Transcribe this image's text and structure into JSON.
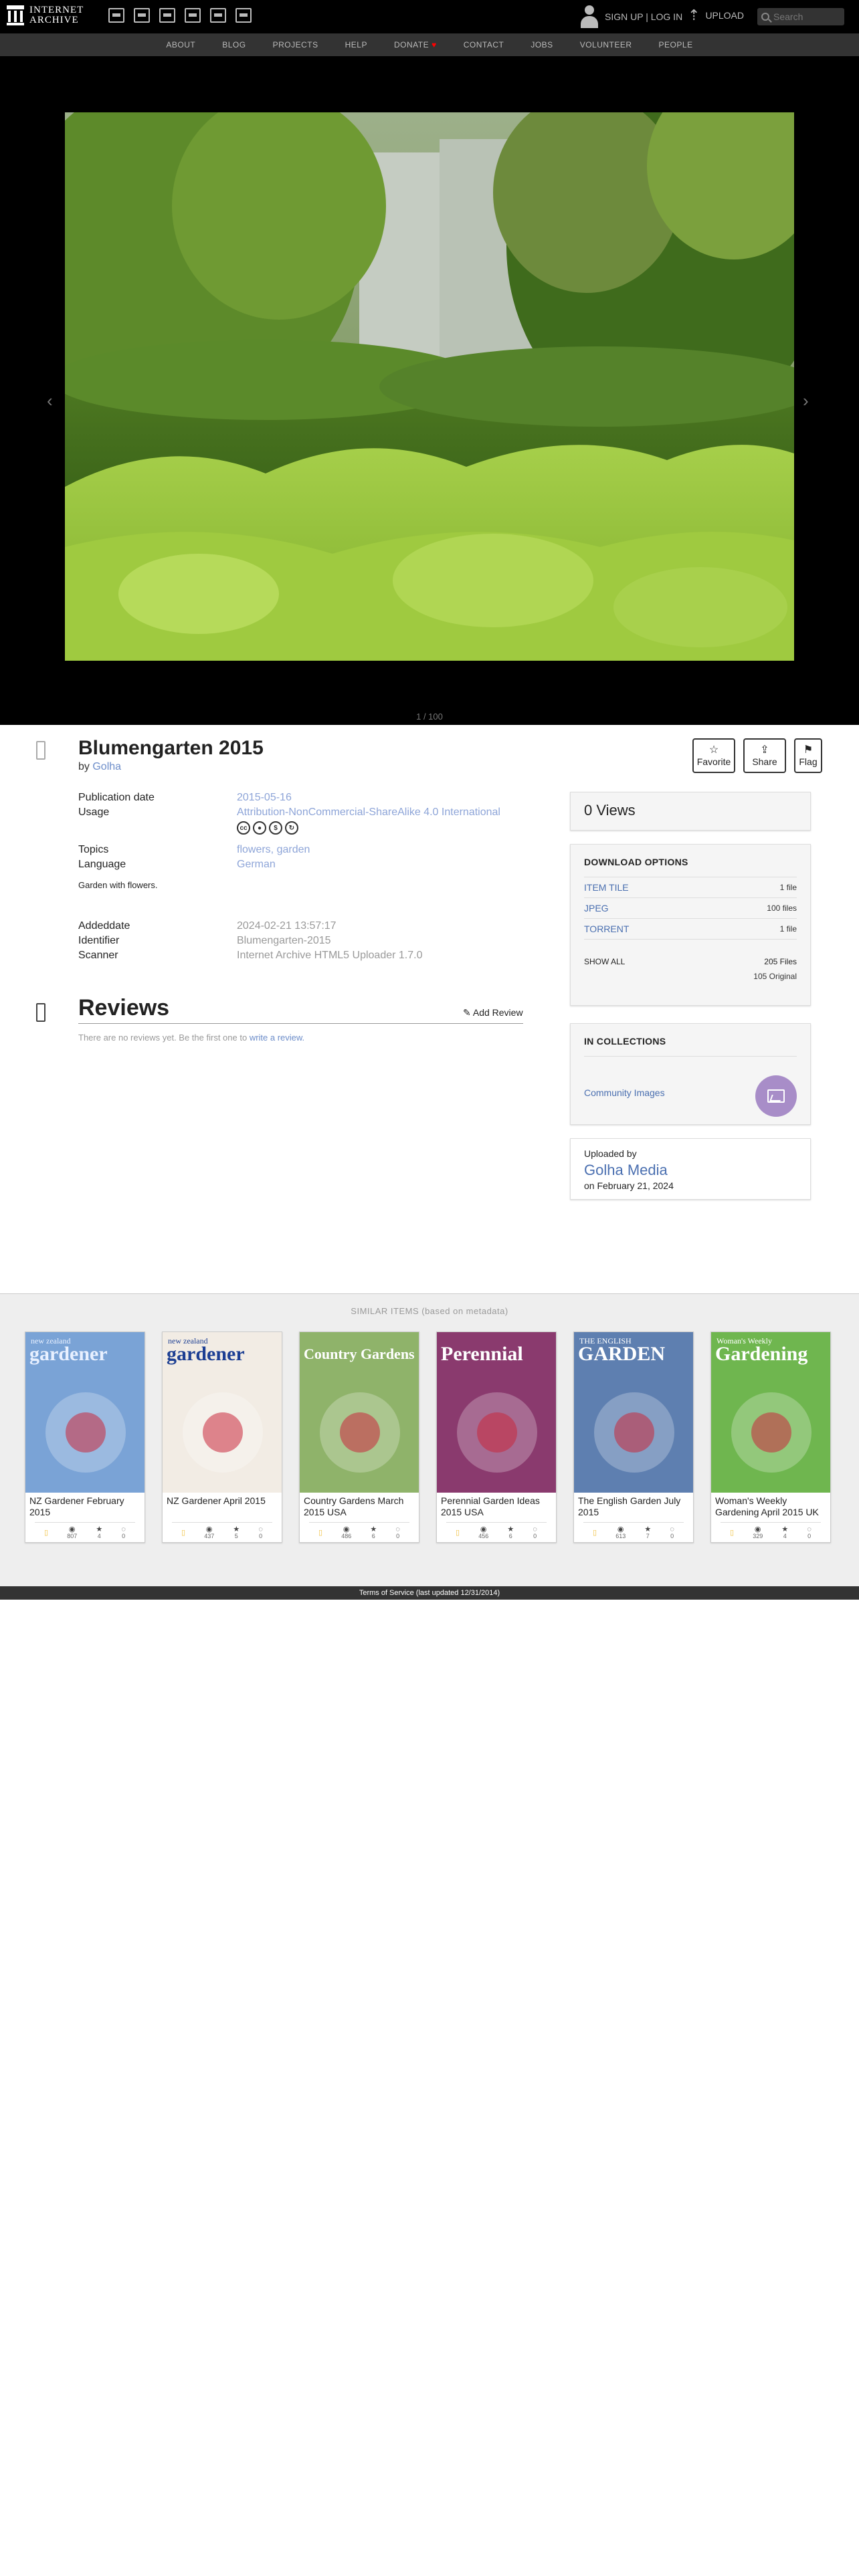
{
  "header": {
    "logo_line1": "INTERNET",
    "logo_line2": "ARCHIVE",
    "media_icons": [
      "web-icon",
      "texts-icon",
      "video-icon",
      "audio-icon",
      "software-icon",
      "images-icon"
    ],
    "auth_text": "SIGN UP | LOG IN",
    "upload_label": "UPLOAD",
    "search_placeholder": "Search"
  },
  "nav": {
    "items": [
      "ABOUT",
      "BLOG",
      "PROJECTS",
      "HELP",
      "DONATE",
      "CONTACT",
      "JOBS",
      "VOLUNTEER",
      "PEOPLE"
    ],
    "donate_heart": "♥"
  },
  "viewer": {
    "prev_glyph": "‹",
    "next_glyph": "›",
    "page_counter": "1 / 100"
  },
  "item": {
    "title": "Blumengarten 2015",
    "by_prefix": "by",
    "creator": "Golha",
    "actions": [
      {
        "icon": "☆",
        "label": "Favorite"
      },
      {
        "icon": "⇪",
        "label": "Share"
      },
      {
        "icon": "⚑",
        "label": "Flag"
      }
    ],
    "metadata": [
      {
        "key": "Publication date",
        "value": "2015-05-16"
      },
      {
        "key": "Usage",
        "value": "Attribution-NonCommercial-ShareAlike 4.0 International"
      }
    ],
    "cc_badges": [
      "cc",
      "by",
      "nc",
      "sa"
    ],
    "metadata_topics": [
      {
        "key": "Topics",
        "value": "flowers, garden"
      },
      {
        "key": "Language",
        "value": "German"
      }
    ],
    "description": "Garden with flowers.",
    "metadata_extra": [
      {
        "key": "Addeddate",
        "value": "2024-02-21 13:57:17"
      },
      {
        "key": "Identifier",
        "value": "Blumengarten-2015"
      },
      {
        "key": "Scanner",
        "value": "Internet Archive HTML5 Uploader 1.7.0"
      }
    ]
  },
  "reviews": {
    "title": "Reviews",
    "add_label": "Add Review",
    "empty_text": "There are no reviews yet. Be the first one to",
    "empty_link": "write a review."
  },
  "sidebar": {
    "views": "0 Views",
    "download_title": "DOWNLOAD OPTIONS",
    "downloads": [
      {
        "label": "ITEM TILE",
        "count": "1 file"
      },
      {
        "label": "JPEG",
        "count": "100 files"
      },
      {
        "label": "TORRENT",
        "count": "1 file"
      }
    ],
    "show_all": "SHOW ALL",
    "total_files": "205 Files",
    "original_files": "105 Original",
    "collections_title": "IN COLLECTIONS",
    "collection_name": "Community Images",
    "uploaded_by_label": "Uploaded by",
    "uploader": "Golha Media",
    "upload_date": "on February 21, 2024"
  },
  "similar": {
    "title": "SIMILAR ITEMS (based on metadata)",
    "items": [
      {
        "title": "NZ Gardener February 2015",
        "views": "807",
        "favs": "4",
        "reviews": "0",
        "mast": "gardener",
        "mast_top": "new zealand",
        "bg": "#7aa3d6",
        "mast_color": "#e8f0ff"
      },
      {
        "title": "NZ Gardener April 2015",
        "views": "437",
        "favs": "5",
        "reviews": "0",
        "mast": "gardener",
        "mast_top": "new zealand",
        "bg": "#f2ece4",
        "mast_color": "#1d3f93"
      },
      {
        "title": "Country Gardens March 2015 USA",
        "views": "486",
        "favs": "6",
        "reviews": "0",
        "mast": "Country Gardens",
        "mast_top": "",
        "bg": "#8fb36a",
        "mast_color": "#ffffff"
      },
      {
        "title": "Perennial Garden Ideas 2015 USA",
        "views": "456",
        "favs": "6",
        "reviews": "0",
        "mast": "Perennial",
        "mast_top": "",
        "bg": "#8a3a6e",
        "mast_color": "#ffffff"
      },
      {
        "title": "The English Garden July 2015",
        "views": "613",
        "favs": "7",
        "reviews": "0",
        "mast": "GARDEN",
        "mast_top": "THE ENGLISH",
        "bg": "#5e7fb0",
        "mast_color": "#ffffff"
      },
      {
        "title": "Woman's Weekly Gardening April 2015 UK",
        "views": "329",
        "favs": "4",
        "reviews": "0",
        "mast": "Gardening",
        "mast_top": "Woman's Weekly",
        "bg": "#6fb64f",
        "mast_color": "#ffffff"
      }
    ]
  },
  "footer": {
    "text": "Terms of Service (last updated 12/31/2014)"
  }
}
